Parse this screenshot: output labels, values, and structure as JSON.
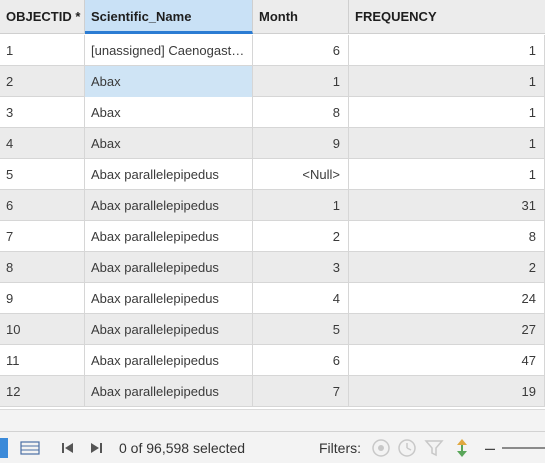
{
  "table": {
    "columns": [
      "OBJECTID *",
      "Scientific_Name",
      "Month",
      "FREQUENCY"
    ],
    "selected_column": 1,
    "rows": [
      {
        "objectid": "1",
        "name": "[unassigned] Caenogastropoda",
        "month": "6",
        "frequency": "1"
      },
      {
        "objectid": "2",
        "name": "Abax",
        "month": "1",
        "frequency": "1"
      },
      {
        "objectid": "3",
        "name": "Abax",
        "month": "8",
        "frequency": "1"
      },
      {
        "objectid": "4",
        "name": "Abax",
        "month": "9",
        "frequency": "1"
      },
      {
        "objectid": "5",
        "name": "Abax parallelepipedus",
        "month": "<Null>",
        "frequency": "1"
      },
      {
        "objectid": "6",
        "name": "Abax parallelepipedus",
        "month": "1",
        "frequency": "31"
      },
      {
        "objectid": "7",
        "name": "Abax parallelepipedus",
        "month": "2",
        "frequency": "8"
      },
      {
        "objectid": "8",
        "name": "Abax parallelepipedus",
        "month": "3",
        "frequency": "2"
      },
      {
        "objectid": "9",
        "name": "Abax parallelepipedus",
        "month": "4",
        "frequency": "24"
      },
      {
        "objectid": "10",
        "name": "Abax parallelepipedus",
        "month": "5",
        "frequency": "27"
      },
      {
        "objectid": "11",
        "name": "Abax parallelepipedus",
        "month": "6",
        "frequency": "47"
      },
      {
        "objectid": "12",
        "name": "Abax parallelepipedus",
        "month": "7",
        "frequency": "19"
      }
    ],
    "selected_cell": {
      "row": 1,
      "col": 1
    }
  },
  "status_bar": {
    "selection_text": "0 of 96,598 selected",
    "filters_label": "Filters:",
    "zoom_minus": "–"
  },
  "colors": {
    "accent": "#2b7cd3",
    "selected_fill": "#cfe4f5",
    "alt_row": "#ebebeb"
  },
  "icons": {
    "table_view": "table-view-icon",
    "grid": "grid-icon",
    "prev": "previous-icon",
    "next": "next-icon",
    "filter_extent": "filter-extent-icon",
    "filter_time": "filter-time-icon",
    "filter_query": "filter-query-icon",
    "filter_range": "filter-range-icon"
  }
}
